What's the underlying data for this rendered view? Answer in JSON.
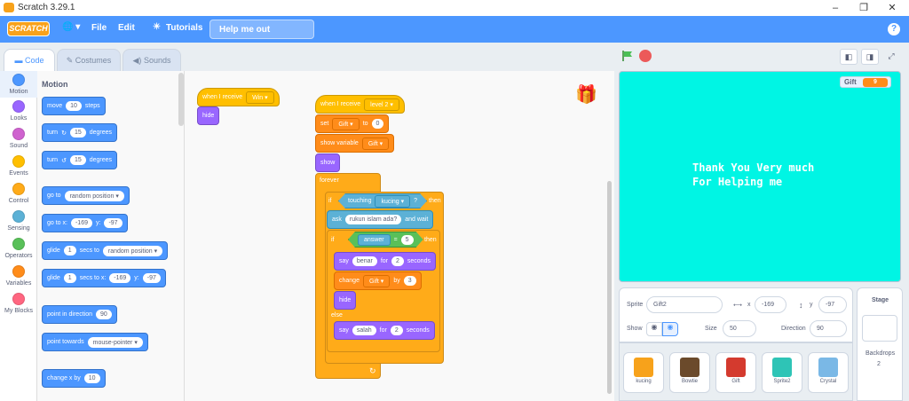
{
  "window": {
    "title": "Scratch 3.29.1",
    "min": "–",
    "max": "❐",
    "close": "✕"
  },
  "menubar": {
    "logo": "SCRATCH",
    "lang": "🌐 ▾",
    "file": "File",
    "edit": "Edit",
    "tutorials": "Tutorials",
    "project_title": "Help me out",
    "help": "?"
  },
  "tabs": {
    "code": "Code",
    "costumes": "Costumes",
    "sounds": "Sounds"
  },
  "categories": [
    {
      "label": "Motion",
      "color": "#4c97ff"
    },
    {
      "label": "Looks",
      "color": "#9966ff"
    },
    {
      "label": "Sound",
      "color": "#cf63cf"
    },
    {
      "label": "Events",
      "color": "#ffbf00"
    },
    {
      "label": "Control",
      "color": "#ffab19"
    },
    {
      "label": "Sensing",
      "color": "#5cb1d6"
    },
    {
      "label": "Operators",
      "color": "#59c059"
    },
    {
      "label": "Variables",
      "color": "#ff8c1a"
    },
    {
      "label": "My Blocks",
      "color": "#ff6680"
    }
  ],
  "palette": {
    "title": "Motion",
    "move": {
      "a": "move",
      "v": "10",
      "b": "steps"
    },
    "turn_r": {
      "a": "turn",
      "icon": "↻",
      "v": "15",
      "b": "degrees"
    },
    "turn_l": {
      "a": "turn",
      "icon": "↺",
      "v": "15",
      "b": "degrees"
    },
    "goto": {
      "a": "go to",
      "v": "random position ▾"
    },
    "gotoxy": {
      "a": "go to x:",
      "x": "-169",
      "b": "y:",
      "y": "-97"
    },
    "glide1": {
      "a": "glide",
      "v": "1",
      "b": "secs to",
      "c": "random position ▾"
    },
    "glide2": {
      "a": "glide",
      "v": "1",
      "b": "secs to x:",
      "x": "-169",
      "c": "y:",
      "y": "-97"
    },
    "point_dir": {
      "a": "point in direction",
      "v": "90"
    },
    "point_towards": {
      "a": "point towards",
      "v": "mouse-pointer ▾"
    },
    "change_x": {
      "a": "change x by",
      "v": "10"
    }
  },
  "script1": {
    "hat": "when I receive",
    "msg": "Win ▾",
    "hide": "hide"
  },
  "script2": {
    "hat": "when I receive",
    "msg": "level 2 ▾",
    "set": "set",
    "set_var": "Gift ▾",
    "set_to": "to",
    "set_val": "0",
    "show_var": "show variable",
    "show_var_name": "Gift ▾",
    "show": "show",
    "forever": "forever",
    "if1": "if",
    "touching": "touching",
    "touch_obj": "kucing ▾",
    "touch_q": "?",
    "then1": "then",
    "ask": "ask",
    "ask_q": "rukun islam ada?",
    "ask_wait": "and wait",
    "if2": "if",
    "answer": "answer",
    "eq": "=",
    "eq_val": "5",
    "then2": "then",
    "say1": "say",
    "say1_txt": "benar",
    "say1_for": "for",
    "say1_n": "2",
    "say1_sec": "seconds",
    "change": "change",
    "change_var": "Gift ▾",
    "change_by": "by",
    "change_val": "3",
    "hide": "hide",
    "else": "else",
    "say2": "say",
    "say2_txt": "salah",
    "say2_for": "for",
    "say2_n": "2",
    "say2_sec": "seconds",
    "loop": "↻"
  },
  "stage": {
    "monitor_label": "Gift",
    "monitor_value": "9",
    "message": "Thank You Very much\nFor Helping me"
  },
  "sprite_info": {
    "sprite_label": "Sprite",
    "sprite_name": "Gift2",
    "x_label": "x",
    "x": "-169",
    "y_label": "y",
    "y": "-97",
    "show_label": "Show",
    "size_label": "Size",
    "size": "50",
    "direction_label": "Direction",
    "direction": "90"
  },
  "sprites": [
    {
      "name": "kucing",
      "color": "#f7a21b"
    },
    {
      "name": "Bowtie",
      "color": "#6b4a2b"
    },
    {
      "name": "Gift",
      "color": "#d43a2e"
    },
    {
      "name": "Sprite2",
      "color": "#2ec4b6"
    },
    {
      "name": "Crystal",
      "color": "#7ab8e6"
    }
  ],
  "stage_panel": {
    "title": "Stage",
    "backdrops_label": "Backdrops",
    "backdrops": "2"
  }
}
